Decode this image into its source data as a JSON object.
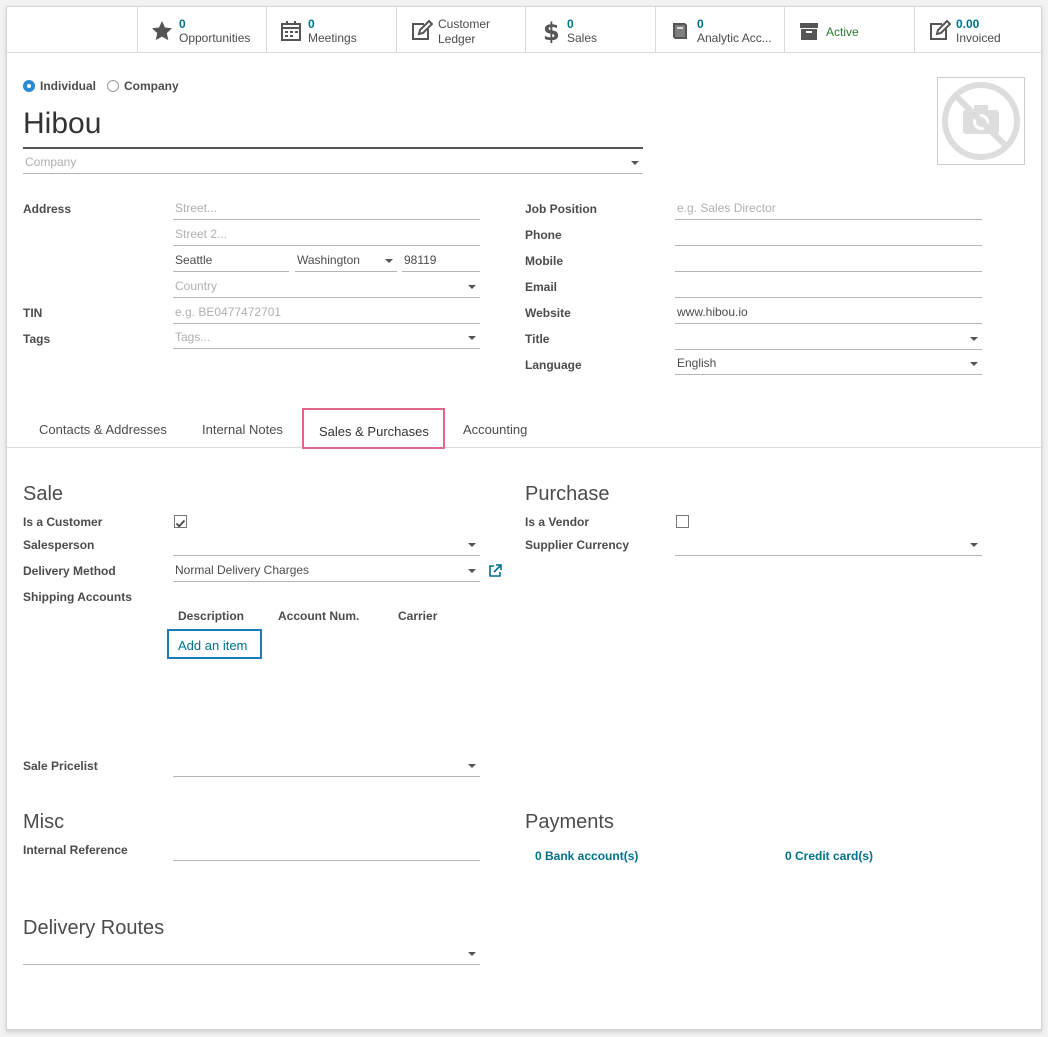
{
  "buttons": [
    {
      "num": "0",
      "label": "Opportunities",
      "icon": "star-icon"
    },
    {
      "num": "0",
      "label": "Meetings",
      "icon": "calendar-icon"
    },
    {
      "line1": "Customer",
      "line2": "Ledger",
      "icon": "edit-icon"
    },
    {
      "num": "0",
      "label": "Sales",
      "icon": "dollar-icon"
    },
    {
      "num": "0",
      "label": "Analytic Acc...",
      "icon": "book-icon"
    },
    {
      "label": "Active",
      "icon": "archive-icon"
    },
    {
      "num": "0.00",
      "label": "Invoiced",
      "icon": "edit-icon"
    }
  ],
  "type_radio": {
    "individual": "Individual",
    "company": "Company",
    "selected": "Individual"
  },
  "partner_name": "Hibou",
  "company_placeholder": "Company",
  "address": {
    "label": "Address",
    "street_ph": "Street...",
    "street2_ph": "Street 2...",
    "city": "Seattle",
    "state": "Washington",
    "zip": "98119",
    "country_ph": "Country"
  },
  "tin": {
    "label": "TIN",
    "placeholder": "e.g. BE0477472701"
  },
  "tags": {
    "label": "Tags",
    "placeholder": "Tags..."
  },
  "right_fields": {
    "job_label": "Job Position",
    "job_ph": "e.g. Sales Director",
    "phone_label": "Phone",
    "mobile_label": "Mobile",
    "email_label": "Email",
    "website_label": "Website",
    "website": "www.hibou.io",
    "title_label": "Title",
    "language_label": "Language",
    "language": "English"
  },
  "tabs": [
    "Contacts & Addresses",
    "Internal Notes",
    "Sales & Purchases",
    "Accounting"
  ],
  "sale": {
    "heading": "Sale",
    "customer_label": "Is a Customer",
    "customer_checked": true,
    "salesperson_label": "Salesperson",
    "delivery_label": "Delivery Method",
    "delivery_value": "Normal Delivery Charges",
    "shipping_label": "Shipping Accounts",
    "cols": [
      "Description",
      "Account Num.",
      "Carrier"
    ],
    "add_item": "Add an item",
    "pricelist_label": "Sale Pricelist"
  },
  "purchase": {
    "heading": "Purchase",
    "vendor_label": "Is a Vendor",
    "vendor_checked": false,
    "currency_label": "Supplier Currency"
  },
  "misc": {
    "heading": "Misc",
    "ref_label": "Internal Reference"
  },
  "payments": {
    "heading": "Payments",
    "bank": "0 Bank account(s)",
    "card": "0 Credit card(s)"
  },
  "routes": {
    "heading": "Delivery Routes"
  }
}
